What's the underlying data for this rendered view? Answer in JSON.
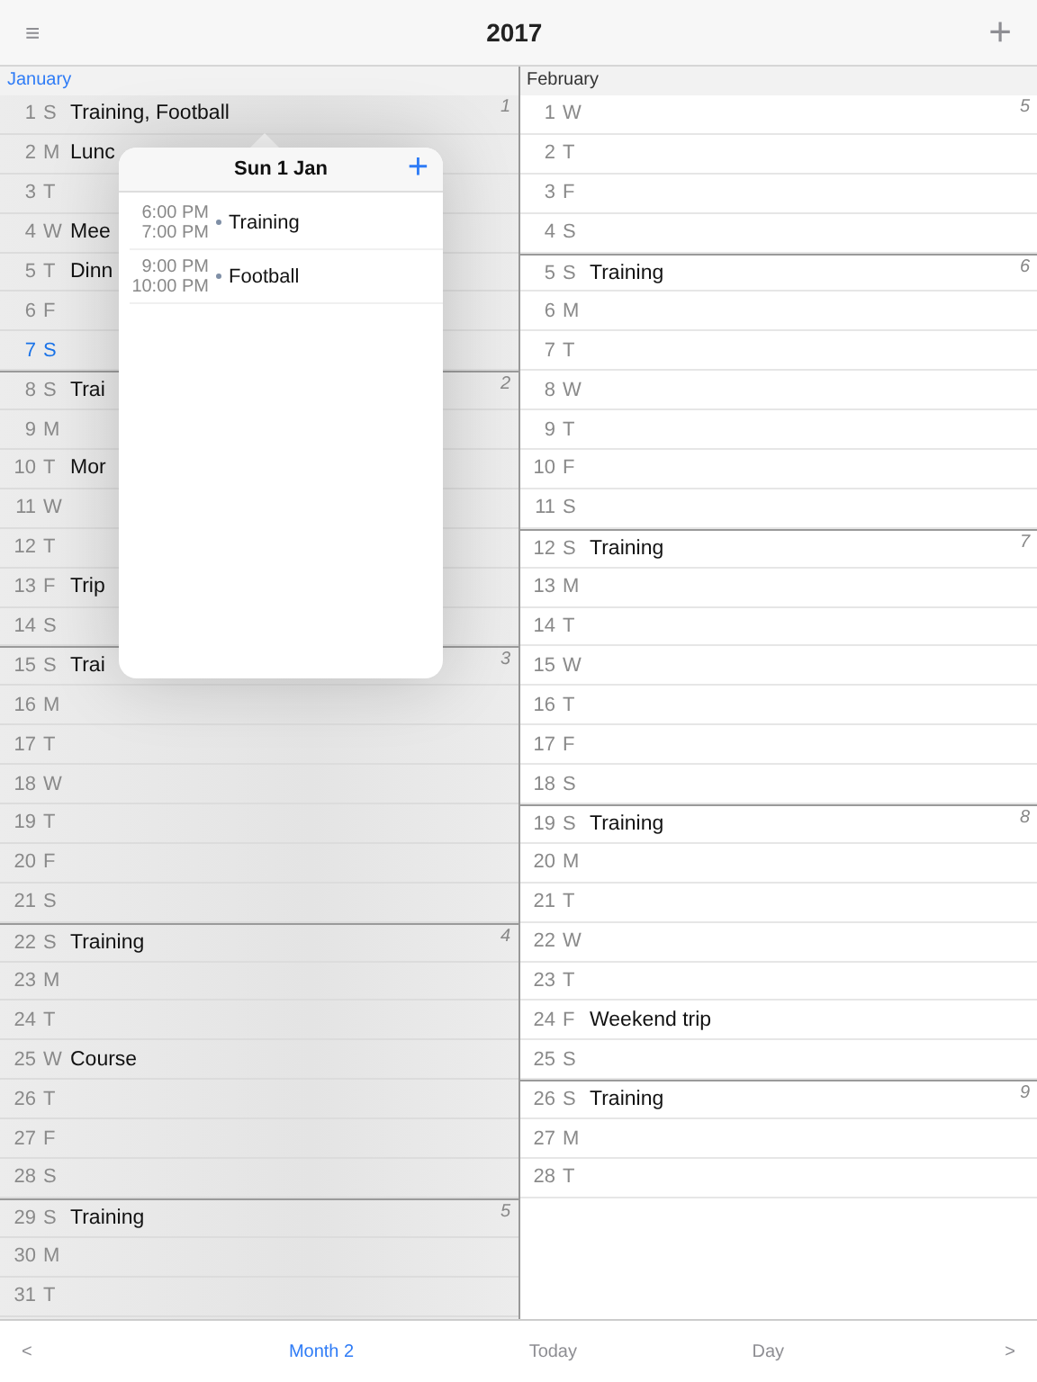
{
  "toolbar": {
    "menu": "≡",
    "title": "2017",
    "add": "+"
  },
  "months": [
    {
      "name": "January",
      "dimmed": true,
      "days": [
        {
          "day": "1",
          "weekday": "S",
          "event": "Training, Football",
          "week": "1",
          "today": false
        },
        {
          "day": "2",
          "weekday": "M",
          "event": "Lunc",
          "today": false
        },
        {
          "day": "3",
          "weekday": "T",
          "today": false
        },
        {
          "day": "4",
          "weekday": "W",
          "event": "Mee",
          "today": false
        },
        {
          "day": "5",
          "weekday": "T",
          "event": "Dinn",
          "today": false
        },
        {
          "day": "6",
          "weekday": "F",
          "today": false
        },
        {
          "day": "7",
          "weekday": "S",
          "today": true
        },
        {
          "day": "8",
          "weekday": "S",
          "event": "Trai",
          "week": "2",
          "today": false
        },
        {
          "day": "9",
          "weekday": "M",
          "today": false
        },
        {
          "day": "10",
          "weekday": "T",
          "event": "Mor",
          "today": false
        },
        {
          "day": "11",
          "weekday": "W",
          "today": false
        },
        {
          "day": "12",
          "weekday": "T",
          "today": false
        },
        {
          "day": "13",
          "weekday": "F",
          "event": "Trip",
          "today": false
        },
        {
          "day": "14",
          "weekday": "S",
          "today": false
        },
        {
          "day": "15",
          "weekday": "S",
          "event": "Trai",
          "week": "3",
          "today": false
        },
        {
          "day": "16",
          "weekday": "M",
          "today": false
        },
        {
          "day": "17",
          "weekday": "T",
          "today": false
        },
        {
          "day": "18",
          "weekday": "W",
          "today": false
        },
        {
          "day": "19",
          "weekday": "T",
          "today": false
        },
        {
          "day": "20",
          "weekday": "F",
          "today": false
        },
        {
          "day": "21",
          "weekday": "S",
          "today": false
        },
        {
          "day": "22",
          "weekday": "S",
          "event": "Training",
          "week": "4",
          "today": false
        },
        {
          "day": "23",
          "weekday": "M",
          "today": false
        },
        {
          "day": "24",
          "weekday": "T",
          "today": false
        },
        {
          "day": "25",
          "weekday": "W",
          "event": "Course",
          "today": false
        },
        {
          "day": "26",
          "weekday": "T",
          "today": false
        },
        {
          "day": "27",
          "weekday": "F",
          "today": false
        },
        {
          "day": "28",
          "weekday": "S",
          "today": false
        },
        {
          "day": "29",
          "weekday": "S",
          "event": "Training",
          "week": "5",
          "today": false
        },
        {
          "day": "30",
          "weekday": "M",
          "today": false
        },
        {
          "day": "31",
          "weekday": "T",
          "today": false
        }
      ]
    },
    {
      "name": "February",
      "dimmed": false,
      "days": [
        {
          "day": "1",
          "weekday": "W",
          "week": "5",
          "today": false
        },
        {
          "day": "2",
          "weekday": "T",
          "today": false
        },
        {
          "day": "3",
          "weekday": "F",
          "today": false
        },
        {
          "day": "4",
          "weekday": "S",
          "today": false
        },
        {
          "day": "5",
          "weekday": "S",
          "event": "Training",
          "week": "6",
          "today": false
        },
        {
          "day": "6",
          "weekday": "M",
          "today": false
        },
        {
          "day": "7",
          "weekday": "T",
          "today": false
        },
        {
          "day": "8",
          "weekday": "W",
          "today": false
        },
        {
          "day": "9",
          "weekday": "T",
          "today": false
        },
        {
          "day": "10",
          "weekday": "F",
          "today": false
        },
        {
          "day": "11",
          "weekday": "S",
          "today": false
        },
        {
          "day": "12",
          "weekday": "S",
          "event": "Training",
          "week": "7",
          "today": false
        },
        {
          "day": "13",
          "weekday": "M",
          "today": false
        },
        {
          "day": "14",
          "weekday": "T",
          "today": false
        },
        {
          "day": "15",
          "weekday": "W",
          "today": false
        },
        {
          "day": "16",
          "weekday": "T",
          "today": false
        },
        {
          "day": "17",
          "weekday": "F",
          "today": false
        },
        {
          "day": "18",
          "weekday": "S",
          "today": false
        },
        {
          "day": "19",
          "weekday": "S",
          "event": "Training",
          "week": "8",
          "today": false
        },
        {
          "day": "20",
          "weekday": "M",
          "today": false
        },
        {
          "day": "21",
          "weekday": "T",
          "today": false
        },
        {
          "day": "22",
          "weekday": "W",
          "today": false
        },
        {
          "day": "23",
          "weekday": "T",
          "today": false
        },
        {
          "day": "24",
          "weekday": "F",
          "event": "Weekend trip",
          "today": false
        },
        {
          "day": "25",
          "weekday": "S",
          "today": false
        },
        {
          "day": "26",
          "weekday": "S",
          "event": "Training",
          "week": "9",
          "today": false
        },
        {
          "day": "27",
          "weekday": "M",
          "today": false
        },
        {
          "day": "28",
          "weekday": "T",
          "today": false
        }
      ]
    }
  ],
  "popover": {
    "title": "Sun 1 Jan",
    "add": "+",
    "events": [
      {
        "start": "6:00 PM",
        "end": "7:00 PM",
        "title": "Training"
      },
      {
        "start": "9:00 PM",
        "end": "10:00 PM",
        "title": "Football"
      }
    ]
  },
  "bottom_bar": {
    "previous": "<",
    "next": ">",
    "tabs": [
      {
        "label": "Month 2",
        "selected": true
      },
      {
        "label": "Today",
        "selected": false
      },
      {
        "label": "Day",
        "selected": false
      }
    ]
  }
}
